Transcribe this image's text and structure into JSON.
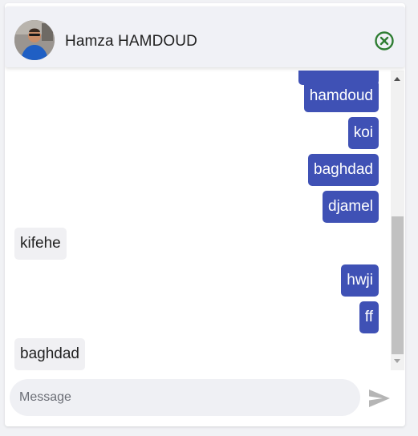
{
  "header": {
    "contact_name": "Hamza HAMDOUD",
    "avatar_icon": "user-avatar-photo",
    "close_icon": "close-circle-icon",
    "close_color": "#2e7d32"
  },
  "messages": [
    {
      "direction": "sent",
      "text": ""
    },
    {
      "direction": "sent",
      "text": "hamdoud"
    },
    {
      "direction": "sent",
      "text": "koi"
    },
    {
      "direction": "sent",
      "text": "baghdad"
    },
    {
      "direction": "sent",
      "text": "djamel"
    },
    {
      "direction": "received",
      "text": "kifehe"
    },
    {
      "direction": "sent",
      "text": "hwji"
    },
    {
      "direction": "sent",
      "text": "ff"
    },
    {
      "direction": "received",
      "text": "baghdad"
    }
  ],
  "composer": {
    "placeholder": "Message",
    "value": "",
    "send_icon": "send-icon"
  },
  "colors": {
    "sent_bubble": "#3f51b5",
    "received_bubble": "#f0f0f3",
    "send_icon": "#b5b5b5"
  }
}
